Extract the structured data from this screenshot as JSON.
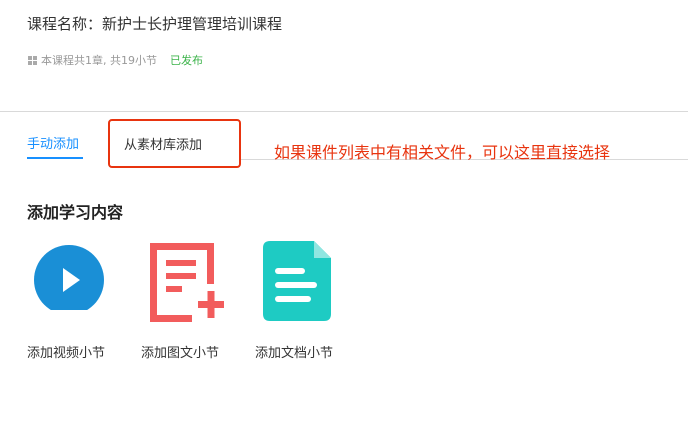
{
  "course": {
    "title": "课程名称：新护士长护理管理培训课程",
    "summary": "本课程共1章, 共19小节",
    "status": "已发布"
  },
  "tabs": [
    {
      "label": "手动添加",
      "active": true
    },
    {
      "label": "从素材库添加",
      "active": false
    }
  ],
  "annotation": "如果课件列表中有相关文件，可以这里直接选择",
  "content": {
    "heading": "添加学习内容",
    "items": [
      {
        "label": "添加视频小节",
        "icon": "play-circle-icon"
      },
      {
        "label": "添加图文小节",
        "icon": "graphic-add-icon"
      },
      {
        "label": "添加文档小节",
        "icon": "document-icon"
      }
    ]
  },
  "colors": {
    "accent": "#1890ff",
    "status": "#3cb34a",
    "annotation": "#e8340f",
    "video": "#1a8fd6",
    "graphic": "#f25c5c",
    "doc": "#1ecbc3"
  }
}
